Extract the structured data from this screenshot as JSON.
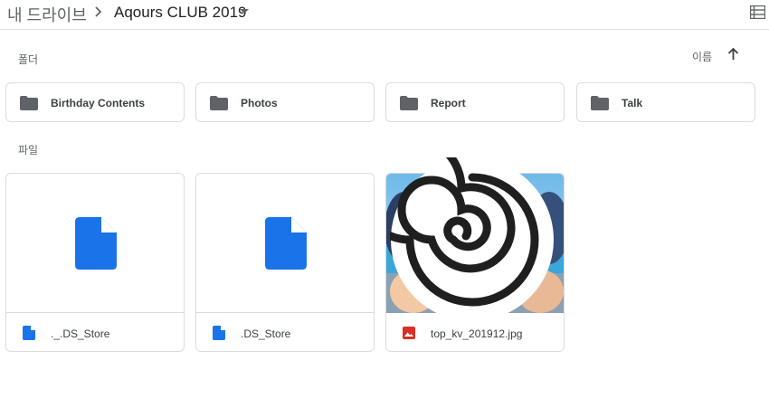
{
  "breadcrumb": {
    "root": "내 드라이브",
    "current": "Aqours CLUB 2019"
  },
  "sections": {
    "folders_label": "폴더",
    "files_label": "파일"
  },
  "sort": {
    "label": "이름"
  },
  "folders": [
    {
      "name": "Birthday Contents"
    },
    {
      "name": "Photos"
    },
    {
      "name": "Report"
    },
    {
      "name": "Talk"
    }
  ],
  "files": [
    {
      "name": "._.DS_Store",
      "type": "doc"
    },
    {
      "name": ".DS_Store",
      "type": "doc"
    },
    {
      "name": "top_kv_201912.jpg",
      "type": "image"
    }
  ],
  "colors": {
    "doc_blue": "#1a73e8",
    "image_red": "#d93025",
    "folder_gray": "#5f6368"
  }
}
